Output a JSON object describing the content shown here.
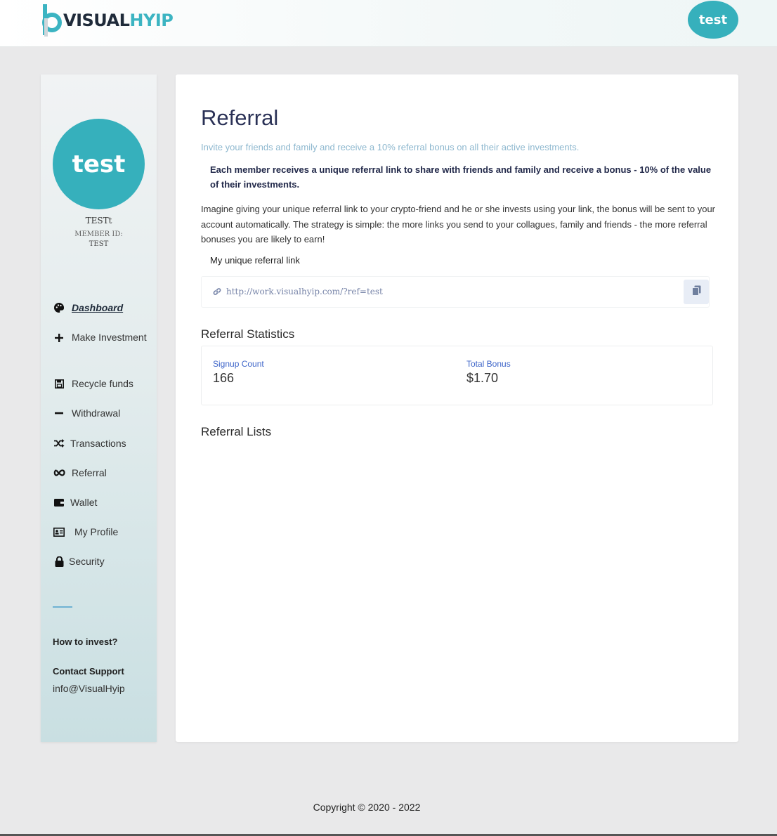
{
  "header": {
    "logo_text_dark": "VISUAL",
    "logo_text_accent": "HYIP",
    "avatar_text": "test"
  },
  "colors": {
    "accent": "#36b0bc",
    "title": "#2a3156",
    "link": "#3f66c9"
  },
  "sidebar": {
    "avatar_text": "test",
    "username": "TESTt",
    "member_id_label": "MEMBER ID:",
    "member_id": "TEST",
    "items": [
      {
        "label": "Dashboard",
        "icon": "palette-icon"
      },
      {
        "label": "Make Investment",
        "icon": "plus-icon"
      },
      {
        "label": "Recycle funds",
        "icon": "save-icon"
      },
      {
        "label": "Withdrawal",
        "icon": "minus-icon"
      },
      {
        "label": "Transactions",
        "icon": "shuffle-icon"
      },
      {
        "label": "Referral",
        "icon": "infinity-icon"
      },
      {
        "label": "Wallet",
        "icon": "wallet-icon"
      },
      {
        "label": "My Profile",
        "icon": "id-card-icon"
      },
      {
        "label": "Security",
        "icon": "lock-icon"
      }
    ],
    "how_to_invest": "How to invest?",
    "contact_support": "Contact Support",
    "email": "info@VisualHyip"
  },
  "main": {
    "title": "Referral",
    "intro": "Invite your friends and family and receive a 10% referral bonus on all their active investments.",
    "callout": "Each member receives a unique referral link to share with friends and family and receive a bonus - 10% of the value of their investments.",
    "paragraph": "Imagine giving your unique referral link to your crypto-friend and he or she invests using your link, the bonus will be sent to your account automatically. The strategy is simple: the more links you send to your collagues, family and friends - the more referral bonuses you are likely to earn!",
    "link_label": "My unique referral link",
    "referral_link": "http://work.visualhyip.com/?ref=test",
    "stats_heading": "Referral Statistics",
    "stats": [
      {
        "label": "Signup Count",
        "value": "166"
      },
      {
        "label": "Total Bonus",
        "value": "$1.70"
      }
    ],
    "lists_heading": "Referral Lists"
  },
  "footer": {
    "copyright": "Copyright © 2020 - 2022"
  }
}
